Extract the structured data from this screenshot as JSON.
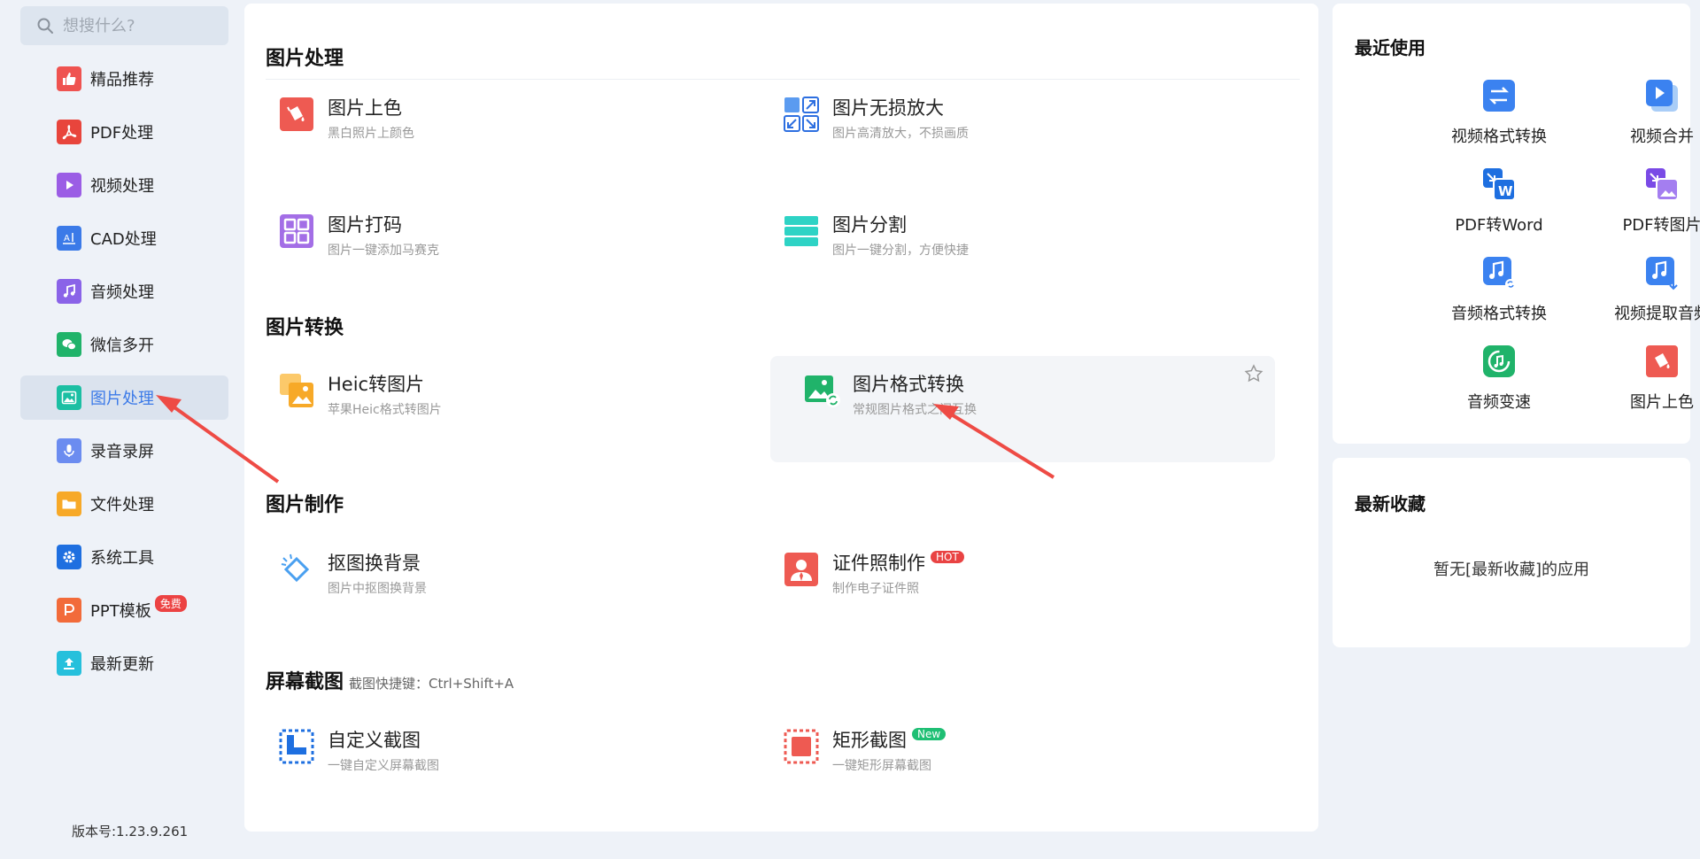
{
  "search": {
    "placeholder": "想搜什么?"
  },
  "sidebar": {
    "items": [
      {
        "label": "精品推荐",
        "icon": "thumbs-up-icon",
        "color": "#ef5350"
      },
      {
        "label": "PDF处理",
        "icon": "pdf-icon",
        "color": "#e8453c"
      },
      {
        "label": "视频处理",
        "icon": "play-icon",
        "color": "#9b5de5"
      },
      {
        "label": "CAD处理",
        "icon": "cad-icon",
        "color": "#3b7ae8"
      },
      {
        "label": "音频处理",
        "icon": "music-icon",
        "color": "#8a63e8"
      },
      {
        "label": "微信多开",
        "icon": "wechat-icon",
        "color": "#20b36a"
      },
      {
        "label": "图片处理",
        "icon": "image-icon",
        "color": "#1bbfa3"
      },
      {
        "label": "录音录屏",
        "icon": "mic-icon",
        "color": "#6b8cf0"
      },
      {
        "label": "文件处理",
        "icon": "folder-icon",
        "color": "#f7a928"
      },
      {
        "label": "系统工具",
        "icon": "gear-icon",
        "color": "#1e6fe0"
      },
      {
        "label": "PPT模板",
        "icon": "ppt-icon",
        "color": "#f26b3a",
        "badge": "免费"
      },
      {
        "label": "最新更新",
        "icon": "upload-icon",
        "color": "#26c0dc"
      }
    ],
    "active_index": 6,
    "version": "版本号:1.23.9.261"
  },
  "main": {
    "sections": [
      {
        "title": "图片处理",
        "tools": [
          {
            "name": "图片上色",
            "desc": "黑白照片上颜色",
            "icon": "paint-bucket-icon"
          },
          {
            "name": "图片无损放大",
            "desc": "图片高清放大，不损画质",
            "icon": "enlarge-icon"
          },
          {
            "name": "图片打码",
            "desc": "图片一键添加马赛克",
            "icon": "mosaic-icon"
          },
          {
            "name": "图片分割",
            "desc": "图片一键分割，方便快捷",
            "icon": "split-icon"
          }
        ]
      },
      {
        "title": "图片转换",
        "tools": [
          {
            "name": "Heic转图片",
            "desc": "苹果Heic格式转图片",
            "icon": "heic-icon"
          },
          {
            "name": "图片格式转换",
            "desc": "常规图片格式之间互换",
            "icon": "image-convert-icon"
          }
        ]
      },
      {
        "title": "图片制作",
        "tools": [
          {
            "name": "抠图换背景",
            "desc": "图片中抠图换背景",
            "icon": "cutout-icon"
          },
          {
            "name": "证件照制作",
            "desc": "制作电子证件照",
            "icon": "id-photo-icon",
            "badge": "HOT"
          }
        ]
      },
      {
        "title": "屏幕截图",
        "subtitle": "截图快捷键：Ctrl+Shift+A",
        "tools": [
          {
            "name": "自定义截图",
            "desc": "一键自定义屏幕截图",
            "icon": "custom-capture-icon"
          },
          {
            "name": "矩形截图",
            "desc": "一键矩形屏幕截图",
            "icon": "rect-capture-icon",
            "badge": "New"
          }
        ]
      }
    ]
  },
  "recent": {
    "title": "最近使用",
    "items": [
      {
        "label": "视频格式转换",
        "icon": "video-convert-icon"
      },
      {
        "label": "视频合并",
        "icon": "video-merge-icon"
      },
      {
        "label": "PDF转Word",
        "icon": "pdf-word-icon"
      },
      {
        "label": "PDF转图片",
        "icon": "pdf-image-icon"
      },
      {
        "label": "音频格式转换",
        "icon": "audio-convert-icon"
      },
      {
        "label": "视频提取音频",
        "icon": "extract-audio-icon"
      },
      {
        "label": "音频变速",
        "icon": "audio-speed-icon"
      },
      {
        "label": "图片上色",
        "icon": "paint-bucket-icon"
      }
    ]
  },
  "favorites": {
    "title": "最新收藏",
    "empty_text": "暂无[最新收藏]的应用"
  }
}
